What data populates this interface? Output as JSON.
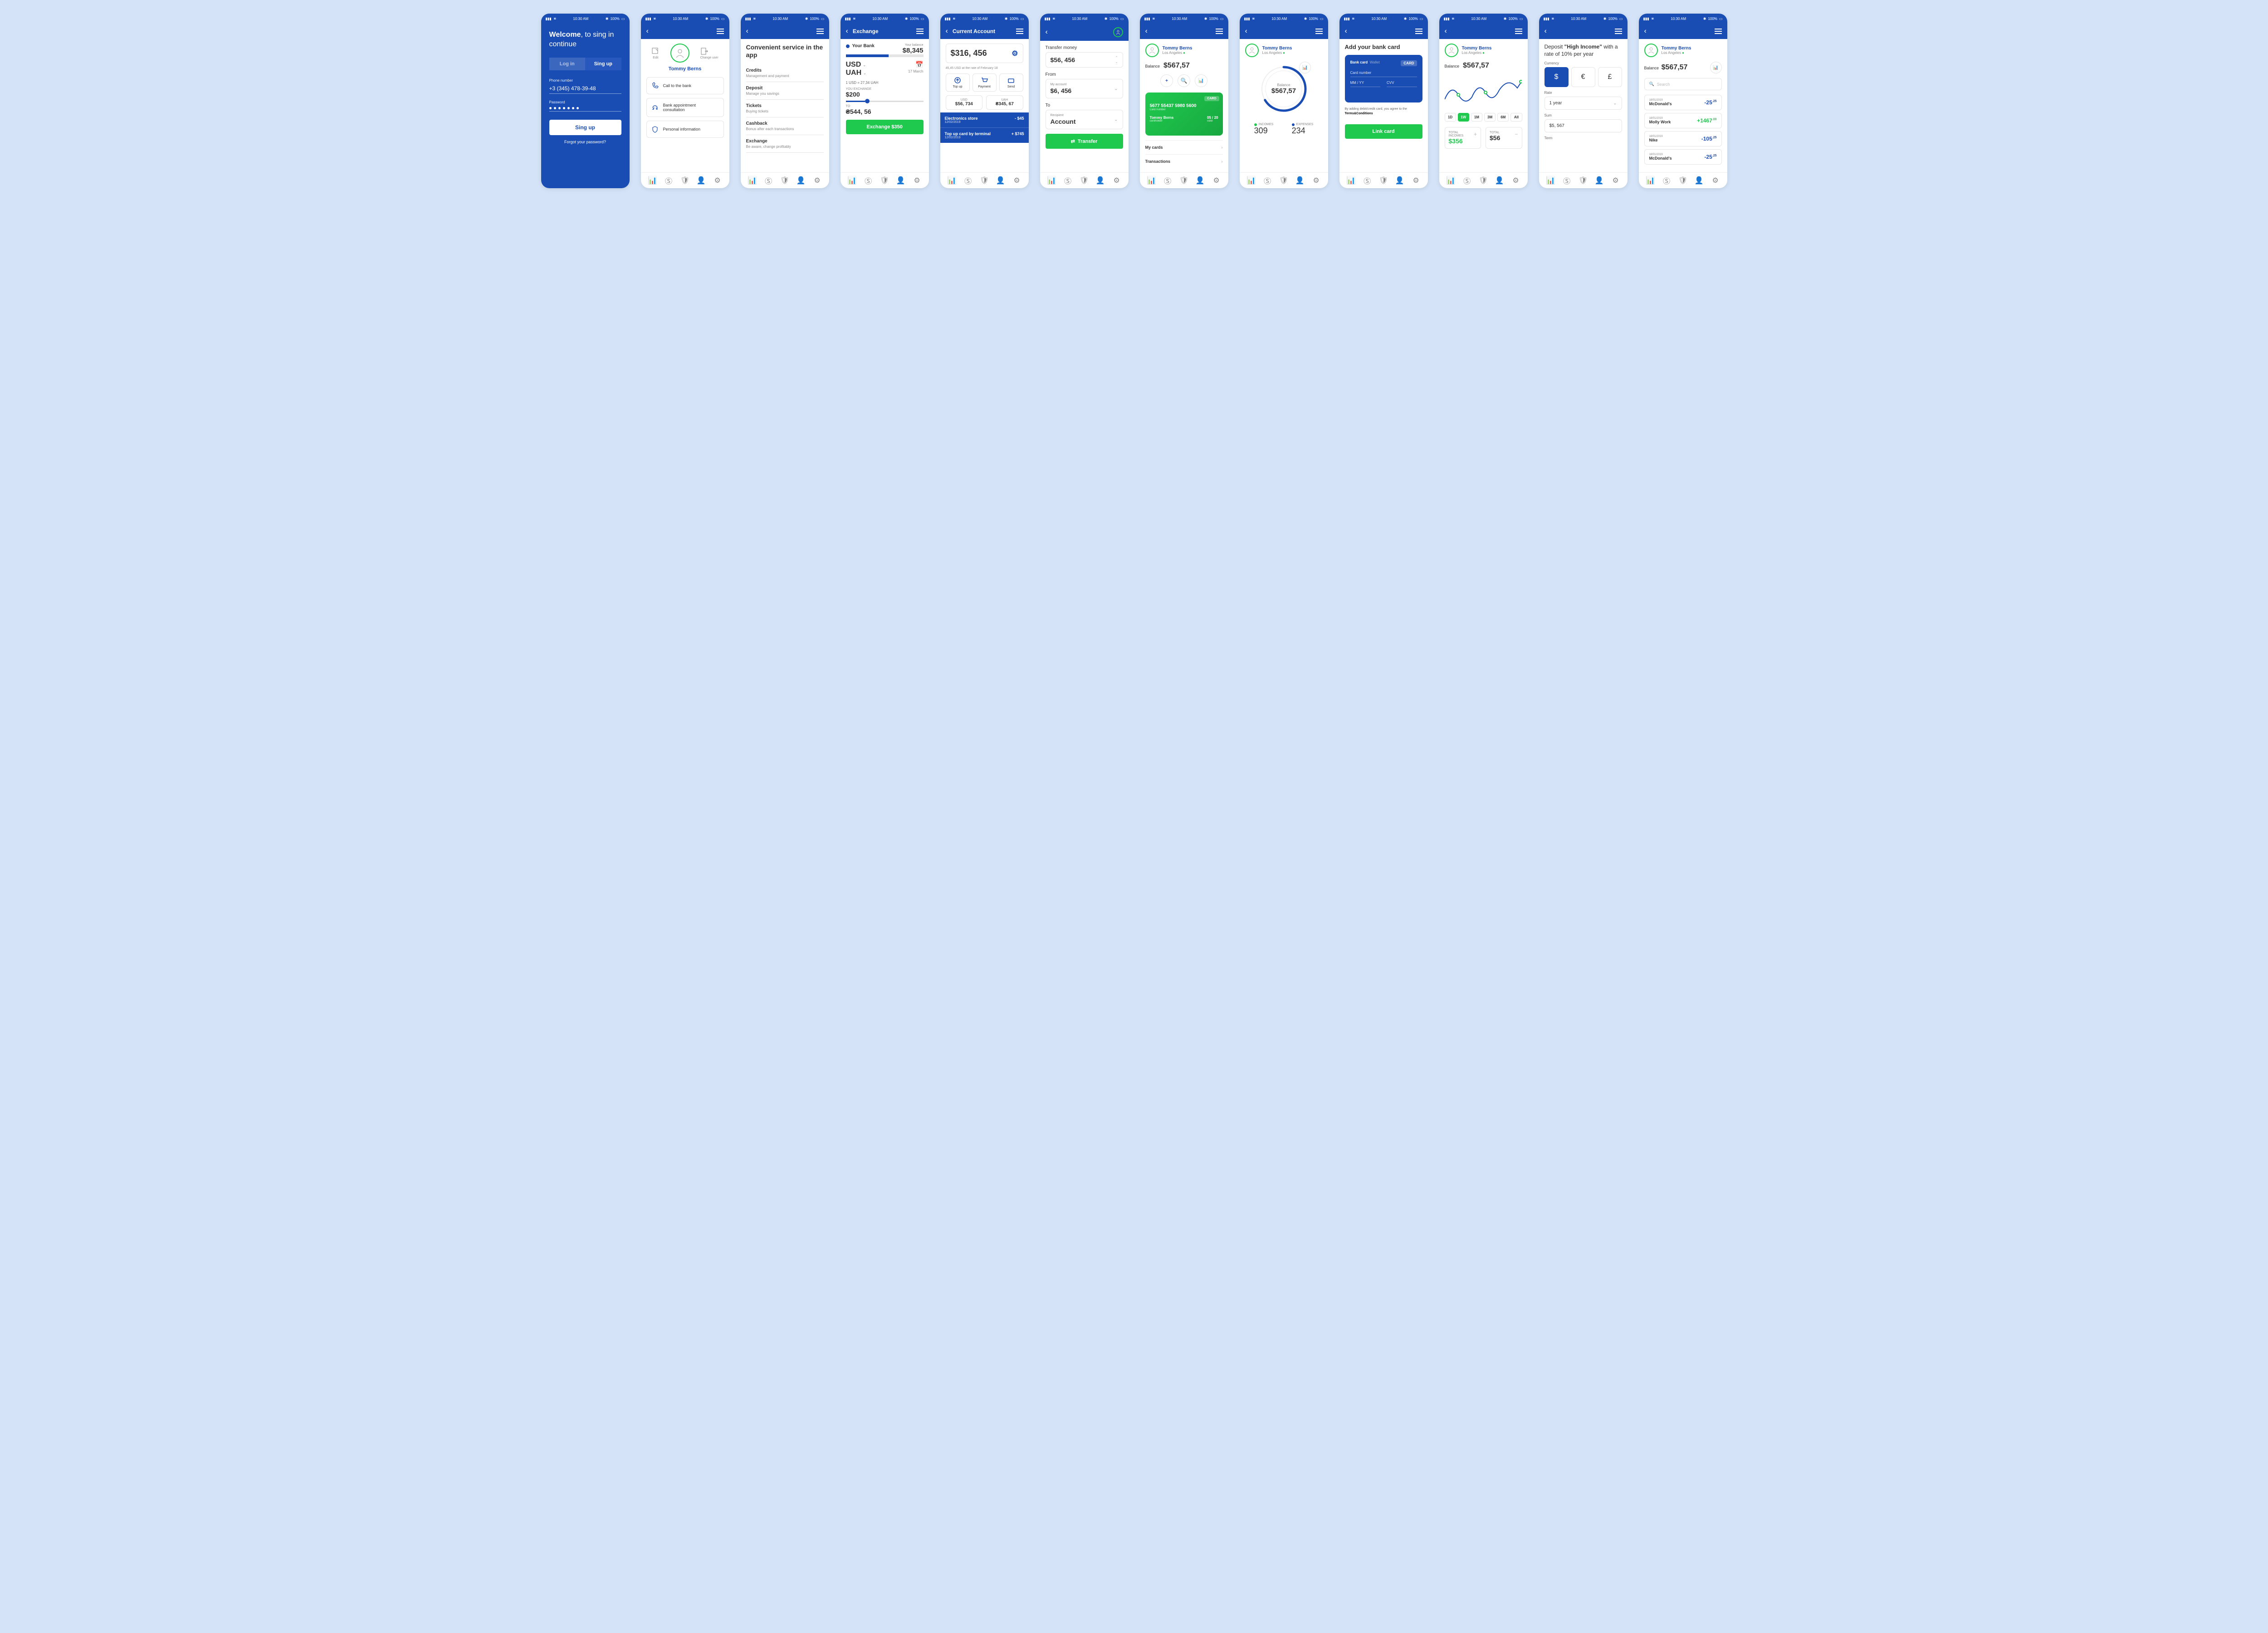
{
  "status": {
    "time": "10:30 AM",
    "battery": "100%"
  },
  "s1": {
    "welcome_b": "Welcome",
    "welcome_rest": ", to sing in continue",
    "login": "Log in",
    "signup": "Sing up",
    "phone_lbl": "Phone number",
    "phone": "+3 (345) 478-39-48",
    "pwd_lbl": "Password",
    "btn": "Sing up",
    "forgot": "Forgot your password?"
  },
  "s2": {
    "edit": "Edit",
    "change": "Change user",
    "name": "Tommy Berns",
    "i1": "Call to the bank",
    "i2": "Bank appointment consultation",
    "i3": "Personal information"
  },
  "s3": {
    "title": "Convenient service in the app",
    "items": [
      {
        "t": "Credits",
        "d": "Management and payment"
      },
      {
        "t": "Deposit",
        "d": "Manage you savings"
      },
      {
        "t": "Tickets",
        "d": "Buying tickets"
      },
      {
        "t": "Cashback",
        "d": "Bonus after each transactions"
      },
      {
        "t": "Exchange",
        "d": "Be aware, change profitably"
      }
    ]
  },
  "s4": {
    "title": "Exchange",
    "bank": "Your Bank",
    "bal_lbl": "Your balance",
    "bal": "$8,345",
    "c1": "USD",
    "c2": "UAH",
    "date": "17 March",
    "rate": "1 USD = 27,34 UAH",
    "exch_lbl": "YOU EXCHANGE",
    "exch": "$200",
    "to_lbl": "TO",
    "to": "₴544, 56",
    "btn": "Exchange $350"
  },
  "s5": {
    "title": "Current Account",
    "bal": "$316, 456",
    "note": "45,45 USD at the rate of February 18",
    "a1": "Top up",
    "a2": "Payment",
    "a3": "Send",
    "usd_l": "USD",
    "usd_v": "$56, 734",
    "uah_l": "UAH",
    "uah_v": "₴345, 67",
    "t1": "Electronics store",
    "t1d": "12/02/2019",
    "t1a": "- $45",
    "t2": "Top up card by terminal",
    "t2d": "12/02/2019",
    "t2a": "+ $745"
  },
  "s6": {
    "title": "Transfer money",
    "amt": "$56, 456",
    "from_lbl": "From",
    "from_acc": "My account",
    "from_val": "$6, 456",
    "to_lbl": "To",
    "to_acc": "Recipient",
    "to_val": "Account",
    "btn": "Transfer"
  },
  "s7": {
    "name": "Tommy Berns",
    "loc": "Los Angeles",
    "bal_lbl": "Balance",
    "bal": "$567,57",
    "cc_badge": "CARD",
    "cc_num": "5677 55437 5980 5600",
    "cc_num_lbl": "Card number",
    "cc_name": "Tommy Berns",
    "cc_name_lbl": "cardholder",
    "cc_exp": "05 / 20",
    "cc_exp_lbl": "valid",
    "l1": "My cards",
    "l2": "Transactions"
  },
  "s8": {
    "name": "Tommy Berns",
    "loc": "Los Angeles",
    "bal_lbl": "Balance",
    "bal": "$567,57",
    "inc_lbl": "INCOMES",
    "inc": "309",
    "exp_lbl": "EXPENSES",
    "exp": "234"
  },
  "s9": {
    "title": "Add your bank card",
    "tab1": "Bank card",
    "tab2": "Wallet",
    "badge": "CARD",
    "f1": "Card number",
    "f2": "MM / YY",
    "f3": "CVV",
    "terms1": "By adding debit/credit card, you agree to the ",
    "terms2": "Terms&Conditions",
    "btn": "Link card"
  },
  "s10": {
    "name": "Tommy Berns",
    "loc": "Los Angeles",
    "bal_lbl": "Balance",
    "bal": "$567,57",
    "periods": [
      "1D",
      "1W",
      "1M",
      "3M",
      "6M",
      "All"
    ],
    "inc_lbl": "TOTAL INCOMES",
    "inc": "$356",
    "exp_lbl": "TOTAL",
    "exp": "$56"
  },
  "s11": {
    "title1": "Deposit ",
    "title2": "\"High Income\"",
    "title3": " with a rate of 10% per year",
    "cur_lbl": "Currency",
    "rate_lbl": "Rate",
    "rate": "1 year",
    "sum_lbl": "Sum",
    "sum": "$5, 567",
    "term_lbl": "Term"
  },
  "s12": {
    "name": "Tommy Berns",
    "loc": "Los Angeles",
    "bal_lbl": "Balance",
    "bal": "$567,57",
    "search": "Search",
    "txns": [
      {
        "d": "18/01/2019",
        "n": "McDonald's",
        "a": "-25",
        "c": ".25",
        "cls": "neg"
      },
      {
        "d": "18/01/2019",
        "n": "Molly Work",
        "a": "+1467",
        "c": ".00",
        "cls": "pos"
      },
      {
        "d": "18/01/2019",
        "n": "Nike",
        "a": "-105",
        "c": ".25",
        "cls": "neg"
      },
      {
        "d": "18/01/2019",
        "n": "McDonald's",
        "a": "-25",
        "c": ".25",
        "cls": "neg"
      }
    ]
  }
}
